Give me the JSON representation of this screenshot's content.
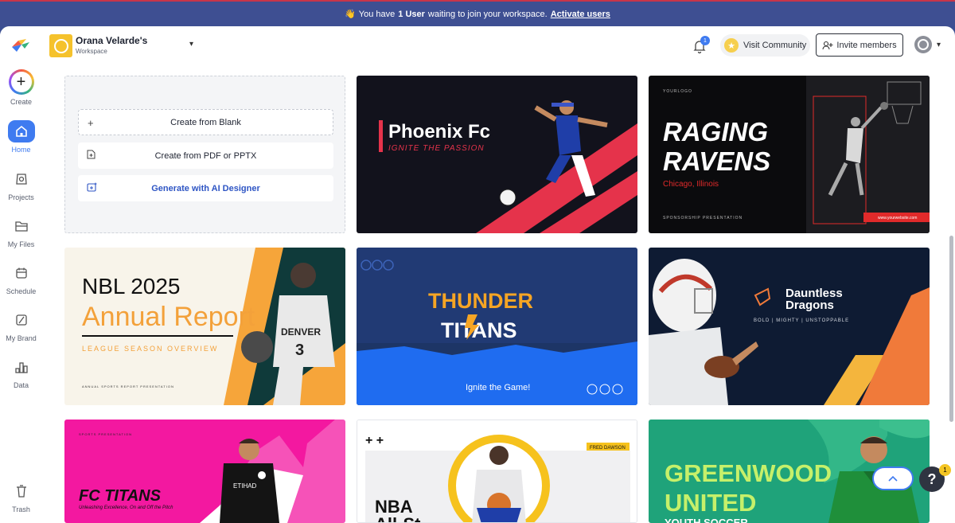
{
  "banner": {
    "prefix": "You have",
    "count_text": "1 User",
    "suffix": "waiting to join your workspace.",
    "link": "Activate users"
  },
  "sidebar": {
    "items": [
      {
        "label": "Create"
      },
      {
        "label": "Home"
      },
      {
        "label": "Projects"
      },
      {
        "label": "My Files"
      },
      {
        "label": "Schedule"
      },
      {
        "label": "My Brand"
      },
      {
        "label": "Data"
      },
      {
        "label": "Trash"
      }
    ]
  },
  "header": {
    "workspace_name": "Orana Velarde's",
    "workspace_sub": "Workspace",
    "notif_count": "1",
    "visit_community": "Visit Community",
    "invite_members": "Invite members"
  },
  "create_options": {
    "blank": "Create from Blank",
    "pdf": "Create from PDF or PPTX",
    "ai": "Generate with AI Designer"
  },
  "templates": {
    "phoenix": {
      "title": "Phoenix Fc",
      "tagline": "IGNITE THE PASSION"
    },
    "ravens": {
      "logo": "YOURLOGO",
      "title1": "RAGING",
      "title2": "RAVENS",
      "place": "Chicago, Illinois",
      "footer": "SPONSORSHIP PRESENTATION",
      "url": "www.yourwebsite.com"
    },
    "nbl": {
      "title1": "NBL 2025",
      "title2": "Annual Report",
      "subtitle": "LEAGUE SEASON OVERVIEW",
      "footer": "ANNUAL SPORTS REPORT PRESENTATION",
      "jersey_name": "DENVER",
      "jersey_number": "3"
    },
    "thunder": {
      "title1": "THUNDER",
      "title2": "TITANS",
      "tagline": "Ignite the Game!"
    },
    "dragons": {
      "title1": "Dauntless",
      "title2": "Dragons",
      "tagline": "BOLD | MIGHTY | UNSTOPPABLE"
    },
    "fctitans": {
      "kicker": "SPORTS PRESENTATION",
      "title": "FC TITANS",
      "tagline": "Unleashing Excellence, On and Off the Pitch"
    },
    "nba": {
      "plus": "+ +",
      "tag": "FRED DAWSON",
      "title": "NBA",
      "title2": "All-St"
    },
    "greenwood": {
      "title1": "GREENWOOD",
      "title2": "UNITED",
      "title3": "YOUTH SOCCER"
    }
  },
  "fab": {
    "up": "^",
    "help": "?",
    "help_badge": "1"
  }
}
